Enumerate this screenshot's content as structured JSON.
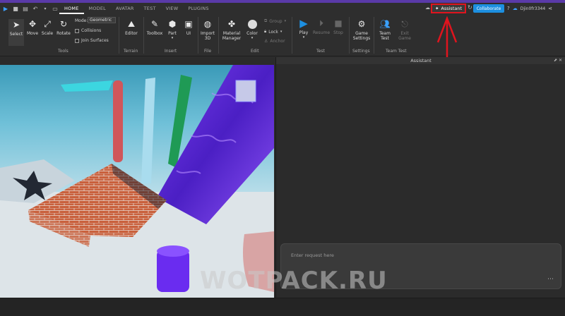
{
  "menubar": {
    "tabs": [
      {
        "label": "HOME",
        "active": true
      },
      {
        "label": "MODEL",
        "active": false
      },
      {
        "label": "AVATAR",
        "active": false
      },
      {
        "label": "TEST",
        "active": false
      },
      {
        "label": "VIEW",
        "active": false
      },
      {
        "label": "PLUGINS",
        "active": false
      }
    ],
    "assistant_label": "Assistant",
    "collaborate_label": "Collaborate",
    "username": "Djin0fr3344"
  },
  "ribbon": {
    "tools": {
      "select": "Select",
      "move": "Move",
      "scale": "Scale",
      "rotate": "Rotate",
      "mode_label": "Mode:",
      "mode_value": "Geometric",
      "collisions": "Collisions",
      "join_surfaces": "Join Surfaces",
      "group": "Tools"
    },
    "terrain": {
      "editor": "Editor",
      "group": "Terrain"
    },
    "insert": {
      "toolbox": "Toolbox",
      "part": "Part",
      "ui": "UI",
      "group": "Insert"
    },
    "file": {
      "import3d_line1": "Import",
      "import3d_line2": "3D",
      "group": "File"
    },
    "edit": {
      "material_line1": "Material",
      "material_line2": "Manager",
      "color": "Color",
      "group_btn": "Group",
      "lock": "Lock",
      "anchor": "Anchor",
      "group": "Edit"
    },
    "test": {
      "play": "Play",
      "resume": "Resume",
      "stop": "Stop",
      "group": "Test"
    },
    "settings": {
      "game_line1": "Game",
      "game_line2": "Settings",
      "group": "Settings"
    },
    "team_test": {
      "team_line1": "Team",
      "team_line2": "Test",
      "exit_line1": "Exit",
      "exit_line2": "Game",
      "group": "Team Test"
    }
  },
  "panel": {
    "title": "Assistant",
    "request_placeholder": "Enter request here"
  },
  "watermark": "WOTPACK.RU",
  "colors": {
    "accent_blue": "#1d8fe0",
    "highlight_red": "#e0141e",
    "purple_strip": "#5a3aa8"
  }
}
